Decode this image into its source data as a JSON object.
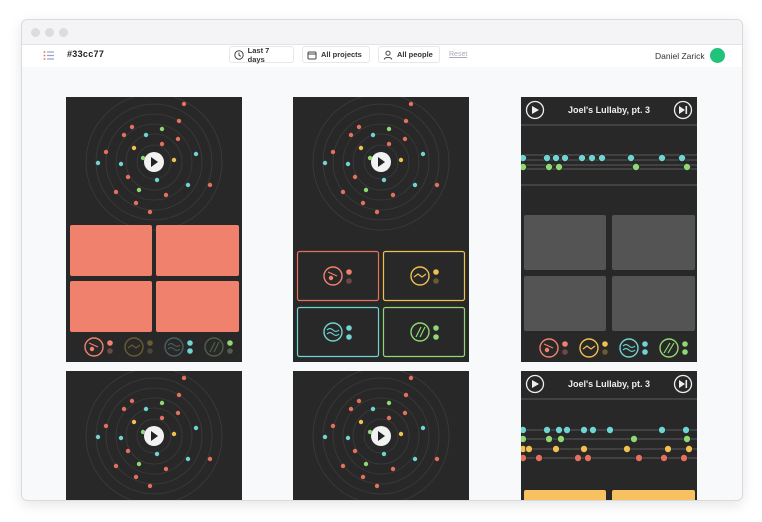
{
  "window": {
    "traffic_lights": [
      "close",
      "minimize",
      "zoom"
    ]
  },
  "toolbar": {
    "doc_title": "#33cc77",
    "filter_time": "Last 7 days",
    "filter_projects": "All projects",
    "filter_people": "All people",
    "reset": "Reset",
    "user_name": "Daniel Zarick"
  },
  "colors": {
    "accent_green": "#21c27a",
    "coral": "#f0826d",
    "yellow": "#f0c050",
    "teal": "#6fd4d2",
    "green": "#8fd873",
    "card_bg": "#282828",
    "pad_gray": "#545454"
  },
  "cards": {
    "player_title": "Joel's Lullaby, pt. 3"
  }
}
